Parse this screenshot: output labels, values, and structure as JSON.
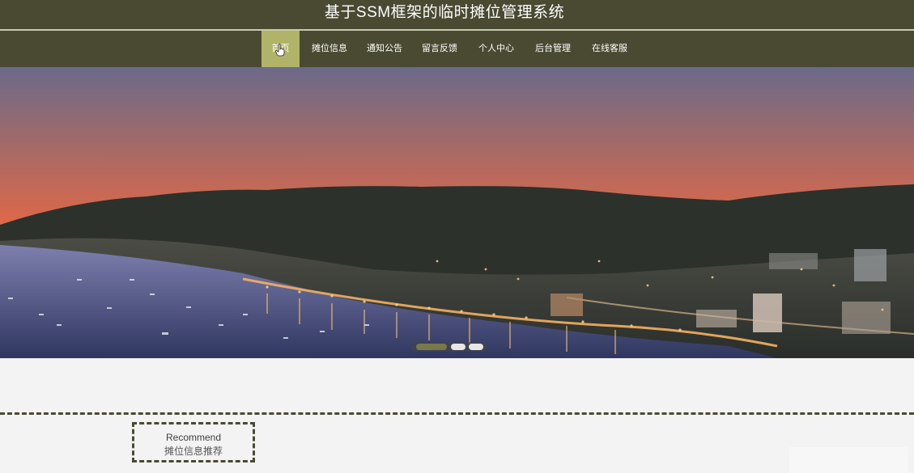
{
  "header": {
    "title": "基于SSM框架的临时摊位管理系统"
  },
  "nav": {
    "items": [
      {
        "label": "首页",
        "active": true
      },
      {
        "label": "摊位信息",
        "active": false
      },
      {
        "label": "通知公告",
        "active": false
      },
      {
        "label": "留言反馈",
        "active": false
      },
      {
        "label": "个人中心",
        "active": false
      },
      {
        "label": "后台管理",
        "active": false
      },
      {
        "label": "在线客服",
        "active": false
      }
    ]
  },
  "banner": {
    "image": "coastal-town-sunset",
    "slides_total": 3,
    "active_slide": 1
  },
  "recommend": {
    "title_en": "Recommend",
    "title_cn": "摊位信息推荐"
  },
  "colors": {
    "header_bg": "#4a4a32",
    "nav_active_bg": "#b1b468",
    "accent_dashed": "#4a4a32",
    "page_bg": "#f3f3f3"
  }
}
